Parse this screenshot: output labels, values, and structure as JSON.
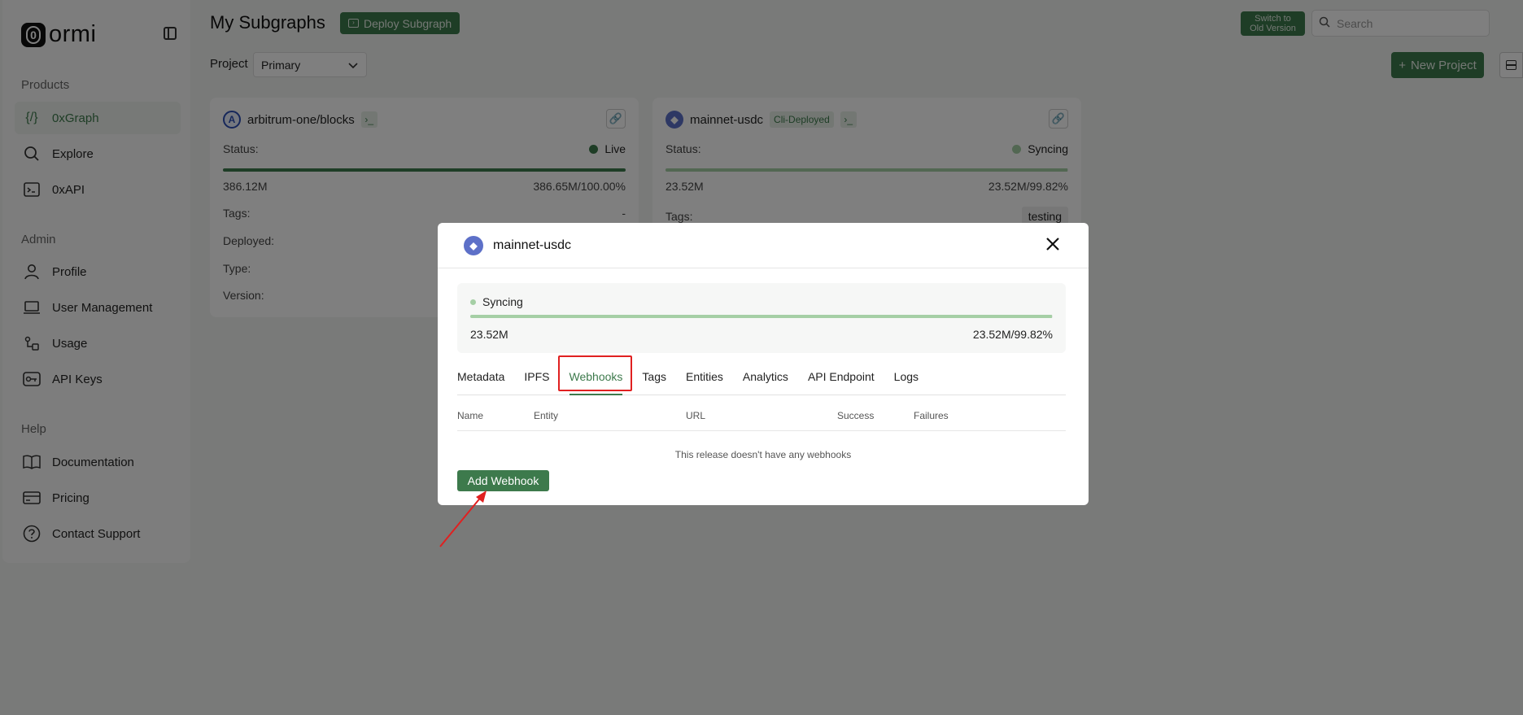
{
  "sidebar": {
    "brand": "ormi",
    "brand_mark": "0",
    "sections": {
      "products": "Products",
      "admin": "Admin",
      "help": "Help"
    },
    "products": [
      {
        "label": "0xGraph",
        "icon": "braces-icon",
        "active": true
      },
      {
        "label": "Explore",
        "icon": "search-icon"
      },
      {
        "label": "0xAPI",
        "icon": "terminal-icon"
      }
    ],
    "admin": [
      {
        "label": "Profile",
        "icon": "user-icon"
      },
      {
        "label": "User Management",
        "icon": "laptop-icon"
      },
      {
        "label": "Usage",
        "icon": "usage-icon"
      },
      {
        "label": "API Keys",
        "icon": "key-icon"
      }
    ],
    "help": [
      {
        "label": "Documentation",
        "icon": "book-icon"
      },
      {
        "label": "Pricing",
        "icon": "card-icon"
      },
      {
        "label": "Contact Support",
        "icon": "help-circle-icon"
      }
    ]
  },
  "header": {
    "title": "My Subgraphs",
    "deploy_label": "Deploy Subgraph",
    "switch_line1": "Switch to",
    "switch_line2": "Old Version",
    "search_placeholder": "Search",
    "project_label": "Project",
    "project_value": "Primary",
    "new_project_label": "New Project"
  },
  "cards": [
    {
      "name": "arbitrum-one/blocks",
      "status_label": "Status:",
      "status": "Live",
      "status_color": "#3d7a4c",
      "progress": 1.0,
      "left_num": "386.12M",
      "right_num": "386.65M/100.00%",
      "tags_label": "Tags:",
      "tags_value": "-",
      "deployed_label": "Deployed:",
      "type_label": "Type:",
      "version_label": "Version:"
    },
    {
      "name": "mainnet-usdc",
      "badge": "Cli-Deployed",
      "status_label": "Status:",
      "status": "Syncing",
      "status_color": "#a5cfa5",
      "progress": 0.9982,
      "left_num": "23.52M",
      "right_num": "23.52M/99.82%",
      "tags_label": "Tags:",
      "tags_value": "testing"
    }
  ],
  "modal": {
    "title": "mainnet-usdc",
    "status": "Syncing",
    "progress": 0.9982,
    "left_num": "23.52M",
    "right_num": "23.52M/99.82%",
    "tabs": [
      "Metadata",
      "IPFS",
      "Webhooks",
      "Tags",
      "Entities",
      "Analytics",
      "API Endpoint",
      "Logs"
    ],
    "active_tab": "Webhooks",
    "columns": [
      "Name",
      "Entity",
      "URL",
      "Success",
      "Failures"
    ],
    "empty_message": "This release doesn't have any webhooks",
    "add_label": "Add Webhook"
  },
  "colors": {
    "accent": "#3d7a4c",
    "annotation": "#e02020"
  }
}
